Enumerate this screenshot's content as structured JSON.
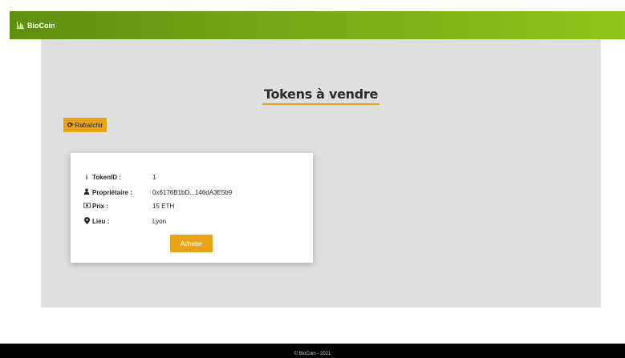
{
  "navbar": {
    "brand": "BioCoin",
    "brand_icon": "chart-bar-icon",
    "color": "#78aa15"
  },
  "page": {
    "title": "Tokens à vendre",
    "accent": "#e8a317"
  },
  "toolbar": {
    "refresh_label": "Rafraîchir",
    "refresh_icon": "sync-icon"
  },
  "token": {
    "id_label": "TokenID :",
    "id_value": "1",
    "owner_label": "Propriétaire :",
    "owner_value": "0x6176B1bD...146dA3E5b9",
    "price_label": "Prix :",
    "price_value": "15 ETH",
    "place_label": "Lieu :",
    "place_value": "Lyon",
    "buy_label": "Acheter"
  },
  "footer": {
    "text": "© BioCoin - 2021"
  }
}
